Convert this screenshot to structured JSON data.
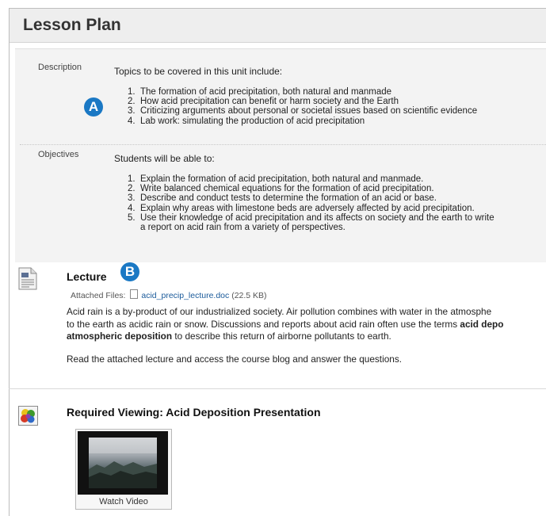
{
  "page": {
    "title": "Lesson Plan"
  },
  "description": {
    "label": "Description",
    "intro": "Topics to be covered in this unit include:",
    "items": [
      "The formation of acid precipitation, both natural and manmade",
      "How acid precipitation can benefit or harm society and the Earth",
      "Criticizing arguments about personal or societal issues based on scientific evidence",
      "Lab work: simulating the production of acid precipitation"
    ]
  },
  "objectives": {
    "label": "Objectives",
    "intro": "Students will be able to:",
    "items": [
      "Explain the formation of acid precipitation, both natural and manmade.",
      "Write balanced chemical equations for the formation of acid precipitation.",
      "Describe and conduct tests to determine the formation of an acid or base.",
      "Explain why areas with limestone beds are adversely affected by acid precipitation.",
      "Use their knowledge of acid precipitation and its affects on society and the earth to write",
      "a report on acid rain from a variety of perspectives."
    ]
  },
  "badges": {
    "a": "A",
    "b": "B"
  },
  "lecture": {
    "title": "Lecture",
    "attached_label": "Attached Files:",
    "file_name": "acid_precip_lecture.doc",
    "file_size": "(22.5 KB)",
    "para1_line1": "Acid rain is a by-product of our industrialized society. Air pollution combines with water in the atmosphe",
    "para1_line2_a": "to the earth as acidic rain or snow. Discussions and reports about acid rain often use the terms ",
    "para1_line2_b": "acid depo",
    "para1_line3_a": "atmospheric deposition",
    "para1_line3_b": " to describe this return of airborne pollutants to earth.",
    "para2": "Read the attached lecture and access the course blog and answer the questions."
  },
  "viewing": {
    "title": "Required Viewing: Acid Deposition Presentation",
    "watch_label": "Watch Video"
  },
  "icons": {
    "document": "document-icon",
    "video": "video-content-icon",
    "file": "file-icon"
  },
  "colors": {
    "badge": "#1a78c4",
    "link": "#1a5a9a",
    "header_bg": "#eeeeee",
    "panel_bg": "#f3f3f3"
  }
}
